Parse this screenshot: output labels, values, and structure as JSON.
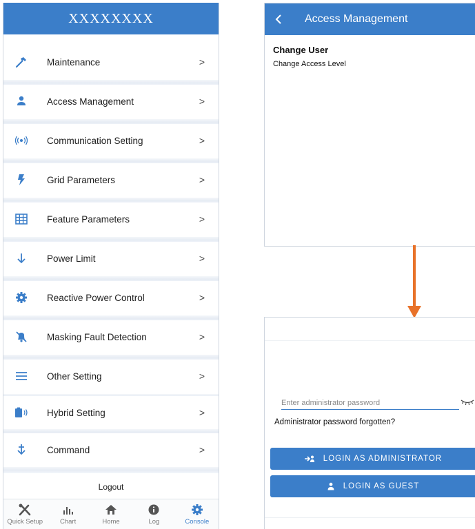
{
  "left": {
    "header_title": "XXXXXXXX",
    "menu": [
      {
        "label": "Maintenance",
        "icon": "hammer-icon",
        "chevron": ">"
      },
      {
        "label": "Access Management",
        "icon": "person-icon",
        "chevron": ">"
      },
      {
        "label": "Communication Setting",
        "icon": "wireless-icon",
        "chevron": ">"
      },
      {
        "label": "Grid Parameters",
        "icon": "lightning-icon",
        "chevron": ">"
      },
      {
        "label": "Feature Parameters",
        "icon": "grid-table-icon",
        "chevron": ">"
      },
      {
        "label": "Power Limit",
        "icon": "down-arrow-icon",
        "chevron": ">"
      },
      {
        "label": "Reactive Power Control",
        "icon": "gear-icon",
        "chevron": ">"
      },
      {
        "label": "Masking Fault Detection",
        "icon": "bell-off-icon",
        "chevron": ">"
      },
      {
        "label": "Other Setting",
        "icon": "list-icon",
        "chevron": ">"
      },
      {
        "label": "Hybrid Setting",
        "icon": "battery-icon",
        "chevron": ">"
      },
      {
        "label": "Command",
        "icon": "command-arrow-icon",
        "chevron": ">"
      }
    ],
    "logout_label": "Logout",
    "tabs": [
      {
        "label": "Quick Setup",
        "icon": "tools-icon",
        "active": false
      },
      {
        "label": "Chart",
        "icon": "bar-chart-icon",
        "active": false
      },
      {
        "label": "Home",
        "icon": "home-icon",
        "active": false
      },
      {
        "label": "Log",
        "icon": "info-icon",
        "active": false
      },
      {
        "label": "Console",
        "icon": "gear-icon",
        "active": true
      }
    ]
  },
  "access": {
    "back_icon": "<",
    "title": "Access Management",
    "change_user": "Change User",
    "change_level": "Change Access Level"
  },
  "login": {
    "password_placeholder": "Enter administrator password",
    "forgot_label": "Administrator password forgotten?",
    "admin_button": "LOGIN AS ADMINISTRATOR",
    "guest_button": "LOGIN AS GUEST"
  },
  "colors": {
    "accent": "#3b7ec9",
    "arrow": "#e8722a"
  }
}
